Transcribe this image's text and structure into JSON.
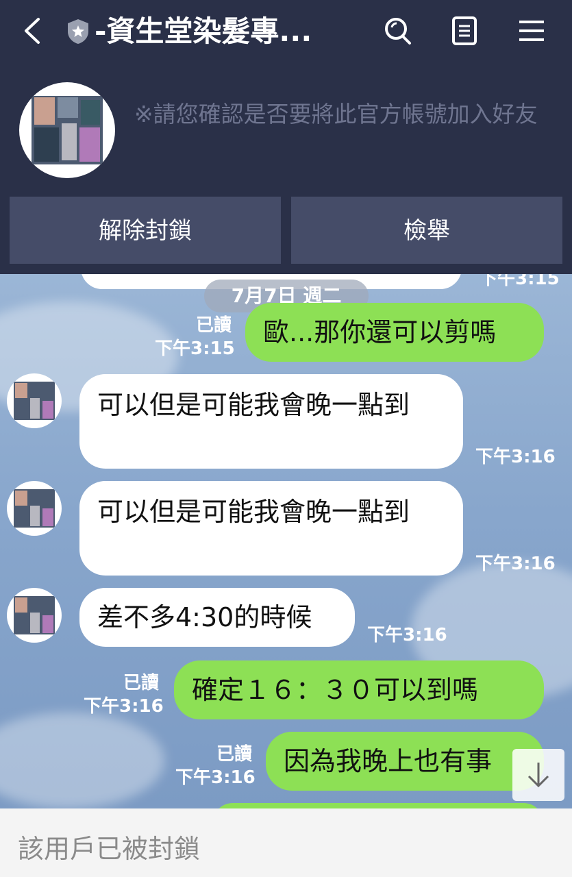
{
  "header": {
    "title": "-資生堂染髮專...",
    "notice": "※請您確認是否要將此官方帳號加入好友",
    "unblock_label": "解除封鎖",
    "report_label": "檢舉"
  },
  "icons": {
    "back": "back-arrow-icon",
    "shield": "official-shield-icon",
    "search": "search-icon",
    "notes": "notes-icon",
    "menu": "menu-icon",
    "scroll_down": "arrow-down-icon"
  },
  "chat": {
    "partial_time": "下午3:15",
    "date_label": "7月7日 週二",
    "messages": [
      {
        "side": "me",
        "text": "歐...那你還可以剪嗎",
        "read": "已讀",
        "time": "下午3:15"
      },
      {
        "side": "them",
        "text": "可以但是可能我會晚一點到",
        "time": "下午3:16"
      },
      {
        "side": "them",
        "text": "可以但是可能我會晚一點到",
        "time": "下午3:16"
      },
      {
        "side": "them",
        "text": "差不多4:30的時候",
        "time": "下午3:16"
      },
      {
        "side": "me",
        "text": "確定１６：３０可以到嗎",
        "read": "已讀",
        "time": "下午3:16"
      },
      {
        "side": "me",
        "text": "因為我晚上也有事",
        "read": "已讀",
        "time": "下午3:16"
      }
    ]
  },
  "footer": {
    "blocked_text": "該用戶已被封鎖"
  },
  "colors": {
    "header_bg": "#2a3048",
    "button_bg": "#454c68",
    "my_bubble": "#8de055",
    "their_bubble": "#ffffff"
  }
}
